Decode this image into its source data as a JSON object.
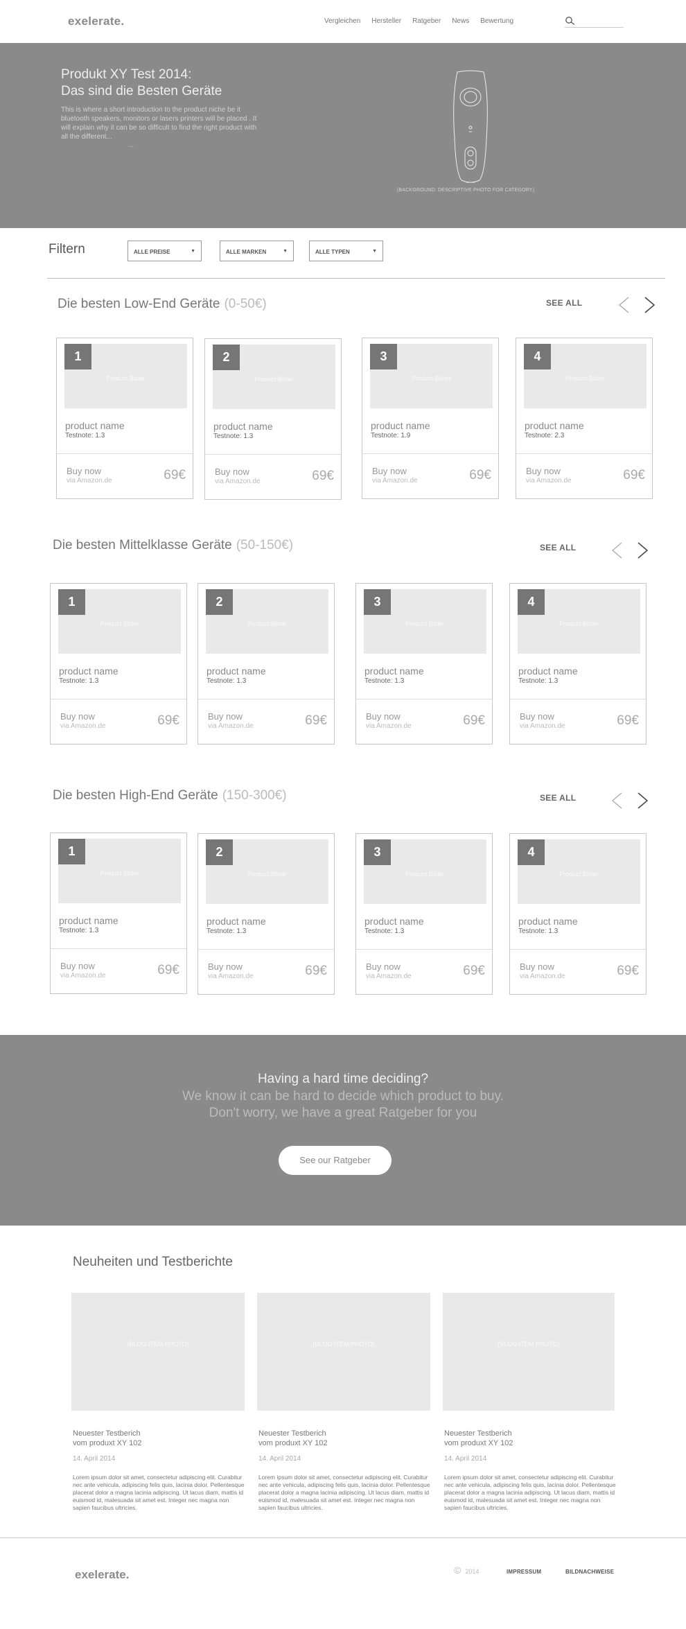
{
  "header": {
    "logo": "exelerate.",
    "nav": [
      "Vergleichen",
      "Hersteller",
      "Ratgeber",
      "News",
      "Bewertung"
    ],
    "search_placeholder": ""
  },
  "hero": {
    "title_line1": "Produkt XY Test 2014:",
    "title_line2": "Das sind die Besten Geräte",
    "intro": "This is where a short introduction to the product niche be it bluetooth speakers, monitors or lasers printers will be placed . It will explain why it can be so difficult to find the right product    with all the different...",
    "ellipsis": "...",
    "caption": "(BACKGROUND: DESCRIPTIVE PHOTO FOR CATEGORY)"
  },
  "filters": {
    "title": "Filtern",
    "buttons": [
      "ALLE PREISE",
      "ALLE MARKEN",
      "ALLE TYPEN"
    ],
    "arrow": "▼"
  },
  "sections": [
    {
      "title": "Die besten  Low-End Geräte",
      "range": "(0-50€)",
      "see_all": "SEE ALL",
      "products": [
        {
          "rank": "1",
          "photo": "Product Bilder",
          "name": "product name",
          "grade": "Testnote: 1.3",
          "buy": "Buy  now",
          "via": "via Amazon.de",
          "price": "69€"
        },
        {
          "rank": "2",
          "photo": "Product Bilder",
          "name": "product name",
          "grade": "Testnote: 1.3",
          "buy": "Buy  now",
          "via": "via Amazon.de",
          "price": "69€"
        },
        {
          "rank": "3",
          "photo": "Product Bilder",
          "name": "product name",
          "grade": "Testnote: 1.9",
          "buy": "Buy  now",
          "via": "via Amazon.de",
          "price": "69€"
        },
        {
          "rank": "4",
          "photo": "Product Bilder",
          "name": "product name",
          "grade": "Testnote: 2.3",
          "buy": "Buy  now",
          "via": "via Amazon.de",
          "price": "69€"
        }
      ]
    },
    {
      "title": "Die besten  Mittelklasse Geräte",
      "range": "(50-150€)",
      "see_all": "SEE ALL",
      "products": [
        {
          "rank": "1",
          "photo": "Product Bilder",
          "name": "product name",
          "grade": "Testnote: 1.3",
          "buy": "Buy  now",
          "via": "via Amazon.de",
          "price": "69€"
        },
        {
          "rank": "2",
          "photo": "Product Bilder",
          "name": "product name",
          "grade": "Testnote: 1.3",
          "buy": "Buy  now",
          "via": "via Amazon.de",
          "price": "69€"
        },
        {
          "rank": "3",
          "photo": "Product Bilder",
          "name": "product name",
          "grade": "Testnote: 1.3",
          "buy": "Buy  now",
          "via": "via Amazon.de",
          "price": "69€"
        },
        {
          "rank": "4",
          "photo": "Product Bilder",
          "name": "product name",
          "grade": "Testnote: 1.3",
          "buy": "Buy  now",
          "via": "via Amazon.de",
          "price": "69€"
        }
      ]
    },
    {
      "title": "Die besten  High-End Geräte",
      "range": "(150-300€)",
      "see_all": "SEE ALL",
      "products": [
        {
          "rank": "1",
          "photo": "Product Bilder",
          "name": "product name",
          "grade": "Testnote: 1.3",
          "buy": "Buy  now",
          "via": "via Amazon.de",
          "price": "69€"
        },
        {
          "rank": "2",
          "photo": "Product Bilder",
          "name": "product name",
          "grade": "Testnote: 1.3",
          "buy": "Buy  now",
          "via": "via Amazon.de",
          "price": "69€"
        },
        {
          "rank": "3",
          "photo": "Product Bilder",
          "name": "product name",
          "grade": "Testnote: 1.3",
          "buy": "Buy  now",
          "via": "via Amazon.de",
          "price": "69€"
        },
        {
          "rank": "4",
          "photo": "Product Bilder",
          "name": "product name",
          "grade": "Testnote: 1.3",
          "buy": "Buy  now",
          "via": "via Amazon.de",
          "price": "69€"
        }
      ]
    }
  ],
  "cta": {
    "title": "Having a hard time deciding?",
    "sub_line1": "We know it can be hard to decide which product to buy.",
    "sub_line2": "Don't worry, we have a great Ratgeber for you",
    "button": "See our Ratgeber"
  },
  "news": {
    "title": "Neuheiten  und Testberichte",
    "items": [
      {
        "photo": "(BLOG ITEM PHOTO)",
        "title_line1": "Neuester Testberich",
        "title_line2": "vom produxt XY 102",
        "date": "14. April 2014",
        "text": "Lorem ipsum dolor sit amet, consectetur adipiscing elit. Curabitur nec ante vehicula, adipiscing felis quis, lacinia dolor. Pellentesque placerat dolor a magna lacinia adipiscing. Ut lacus diam, mattis id euismod id, malesuada sit amet est. Integer nec magna non sapien faucibus ultricies."
      },
      {
        "photo": "(BLOG ITEM PHOTO)",
        "title_line1": "Neuester Testberich",
        "title_line2": "vom produxt XY 102",
        "date": "14. April 2014",
        "text": "Lorem ipsum dolor sit amet, consectetur adipiscing elit. Curabitur nec ante vehicula, adipiscing felis quis, lacinia dolor. Pellentesque placerat dolor a magna lacinia adipiscing. Ut lacus diam, mattis id euismod id, malesuada sit amet est. Integer nec magna non sapien faucibus ultricies."
      },
      {
        "photo": "(BLOG ITEM PHOTO)",
        "title_line1": "Neuester Testberich",
        "title_line2": "vom produxt XY 102",
        "date": "14. April 2014",
        "text": "Lorem ipsum dolor sit amet, consectetur adipiscing elit. Curabitur nec ante vehicula, adipiscing felis quis, lacinia dolor. Pellentesque placerat dolor a magna lacinia adipiscing. Ut lacus diam, mattis id euismod id, malesuada sit amet est. Integer nec magna non sapien faucibus ultricies."
      }
    ]
  },
  "footer": {
    "logo": "exelerate.",
    "copyright_symbol": "©",
    "year": "2014",
    "links": [
      "IMPRESSUM",
      "BILDNACHWEISE"
    ]
  },
  "colors": {
    "hero_bg": "#8a8a8a",
    "rank_badge": "#767676",
    "photo_placeholder": "#e9e9e9"
  }
}
